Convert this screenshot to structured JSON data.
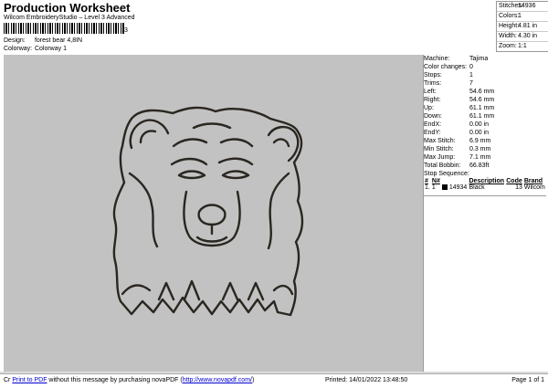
{
  "header": {
    "title": "Production Worksheet",
    "subtitle": "Wilcom EmbroideryStudio – Level 3 Advanced",
    "barcode_suffix": "3"
  },
  "design": {
    "design_label": "Design:",
    "design_value": "forest bear 4,8IN",
    "colorway_label": "Colorway:",
    "colorway_value": "Colorway 1"
  },
  "stats": [
    {
      "k": "Stitches:",
      "v": "14936"
    },
    {
      "k": "Colors:",
      "v": "1"
    },
    {
      "k": "Height:",
      "v": "4.81 in"
    },
    {
      "k": "Width:",
      "v": "4.30 in"
    },
    {
      "k": "Zoom:",
      "v": "1:1"
    }
  ],
  "machine": [
    {
      "k": "Machine:",
      "v": "Tajima"
    },
    {
      "k": "Color changes:",
      "v": "0"
    },
    {
      "k": "Stops:",
      "v": "1"
    },
    {
      "k": "Trims:",
      "v": "7"
    },
    {
      "k": "Left:",
      "v": "54.6 mm"
    },
    {
      "k": "Right:",
      "v": "54.6 mm"
    },
    {
      "k": "Up:",
      "v": "61.1 mm"
    },
    {
      "k": "Down:",
      "v": "61.1 mm"
    },
    {
      "k": "EndX:",
      "v": "0.00 in"
    },
    {
      "k": "EndY:",
      "v": "0.00 in"
    },
    {
      "k": "Max Stitch:",
      "v": "6.9 mm"
    },
    {
      "k": "Min Stitch:",
      "v": "0.3 mm"
    },
    {
      "k": "Max Jump:",
      "v": "7.1 mm"
    },
    {
      "k": "Total Bobbin:",
      "v": "66.83ft"
    }
  ],
  "sequence": {
    "label": "Stop Sequence:",
    "headers": [
      "#",
      "N#",
      "",
      "Description",
      "Code",
      "Brand"
    ],
    "rows": [
      {
        "num": "1.",
        "n": "1",
        "code_left": "14934",
        "desc": "Black",
        "code": "13",
        "brand": "Wilcom",
        "color": "#000000"
      }
    ]
  },
  "footer": {
    "prefix": "Cr",
    "link1": "Print to PDF",
    "text1": "without this message by purchasing novaPDF (",
    "link2": "http://www.novapdf.com/",
    "text2": ")",
    "printed": "Printed: 14/01/2022 13:48:50",
    "page": "Page 1 of 1"
  }
}
